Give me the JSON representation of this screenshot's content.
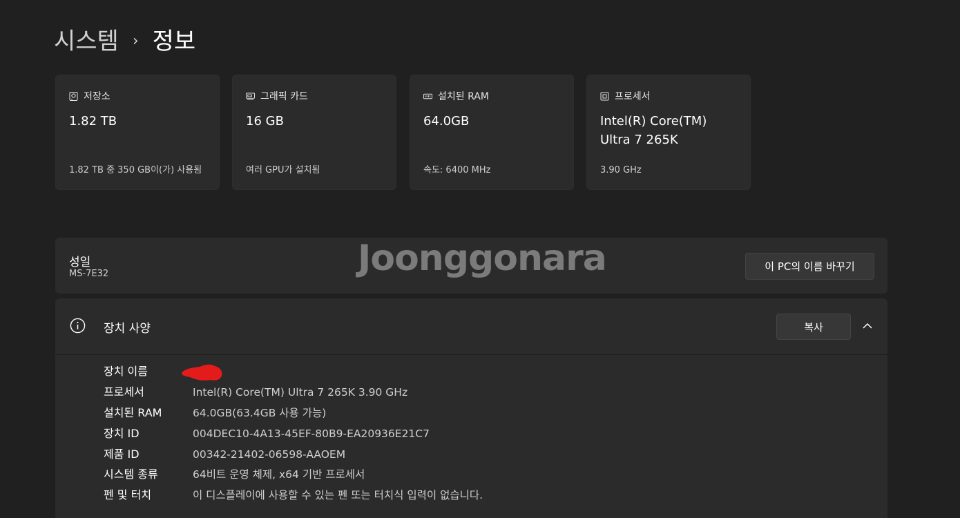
{
  "breadcrumb": {
    "parent": "시스템",
    "separator": "›",
    "current": "정보"
  },
  "cards": [
    {
      "icon": "storage-icon",
      "title": "저장소",
      "value": "1.82 TB",
      "sub": "1.82 TB 중 350 GB이(가) 사용됨"
    },
    {
      "icon": "graphics-card-icon",
      "title": "그래픽 카드",
      "value": "16 GB",
      "sub": "여러 GPU가 설치됨"
    },
    {
      "icon": "ram-icon",
      "title": "설치된 RAM",
      "value": "64.0GB",
      "sub": "속도: 6400 MHz"
    },
    {
      "icon": "processor-icon",
      "title": "프로세서",
      "value": "Intel(R) Core(TM) Ultra 7 265K",
      "sub": "3.90 GHz"
    }
  ],
  "device": {
    "name": "성일",
    "model": "MS-7E32",
    "rename_button": "이 PC의 이름 바꾸기"
  },
  "watermark": "Joonggonara",
  "specs": {
    "title": "장치 사양",
    "copy_button": "복사",
    "rows": [
      {
        "label": "장치 이름",
        "value": ""
      },
      {
        "label": "프로세서",
        "value": "Intel(R) Core(TM) Ultra 7 265K   3.90 GHz"
      },
      {
        "label": "설치된 RAM",
        "value": "64.0GB(63.4GB 사용 가능)"
      },
      {
        "label": "장치 ID",
        "value": "004DEC10-4A13-45EF-80B9-EA20936E21C7"
      },
      {
        "label": "제품 ID",
        "value": "00342-21402-06598-AAOEM"
      },
      {
        "label": "시스템 종류",
        "value": "64비트 운영 체제, x64 기반 프로세서"
      },
      {
        "label": "펜 및 터치",
        "value": "이 디스플레이에 사용할 수 있는 펜 또는 터치식 입력이 없습니다."
      }
    ]
  },
  "colors": {
    "background": "#202020",
    "card": "#2b2b2b",
    "redaction": "#e31b1b"
  }
}
